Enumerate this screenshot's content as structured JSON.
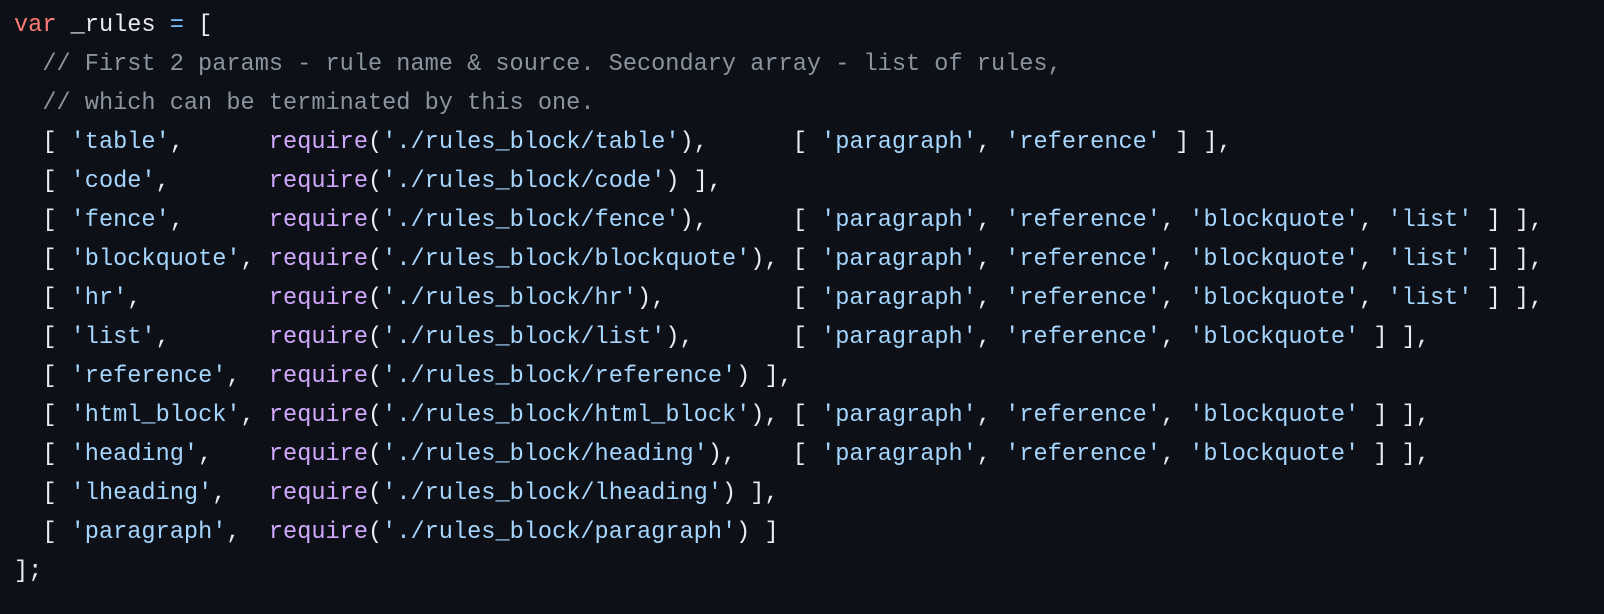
{
  "theme": {
    "background": "#0d1117",
    "text": "#e6edf3",
    "keyword": "#ff7b72",
    "operator": "#79c0ff",
    "comment": "#8b949e",
    "string": "#a5d6ff",
    "function": "#d2a8ff"
  },
  "code": {
    "lines": [
      [
        [
          "kw",
          "var"
        ],
        [
          "p",
          " _rules "
        ],
        [
          "op",
          "="
        ],
        [
          "p",
          " ["
        ]
      ],
      [
        [
          "cm",
          "  // First 2 params - rule name & source. Secondary array - list of rules,"
        ]
      ],
      [
        [
          "cm",
          "  // which can be terminated by this one."
        ]
      ],
      [
        [
          "p",
          "  [ "
        ],
        [
          "str",
          "'table'"
        ],
        [
          "p",
          ",      "
        ],
        [
          "fn",
          "require"
        ],
        [
          "p",
          "("
        ],
        [
          "str",
          "'./rules_block/table'"
        ],
        [
          "p",
          "),      [ "
        ],
        [
          "str",
          "'paragraph'"
        ],
        [
          "p",
          ", "
        ],
        [
          "str",
          "'reference'"
        ],
        [
          "p",
          " ] ],"
        ]
      ],
      [
        [
          "p",
          "  [ "
        ],
        [
          "str",
          "'code'"
        ],
        [
          "p",
          ",       "
        ],
        [
          "fn",
          "require"
        ],
        [
          "p",
          "("
        ],
        [
          "str",
          "'./rules_block/code'"
        ],
        [
          "p",
          ") ],"
        ]
      ],
      [
        [
          "p",
          "  [ "
        ],
        [
          "str",
          "'fence'"
        ],
        [
          "p",
          ",      "
        ],
        [
          "fn",
          "require"
        ],
        [
          "p",
          "("
        ],
        [
          "str",
          "'./rules_block/fence'"
        ],
        [
          "p",
          "),      [ "
        ],
        [
          "str",
          "'paragraph'"
        ],
        [
          "p",
          ", "
        ],
        [
          "str",
          "'reference'"
        ],
        [
          "p",
          ", "
        ],
        [
          "str",
          "'blockquote'"
        ],
        [
          "p",
          ", "
        ],
        [
          "str",
          "'list'"
        ],
        [
          "p",
          " ] ],"
        ]
      ],
      [
        [
          "p",
          "  [ "
        ],
        [
          "str",
          "'blockquote'"
        ],
        [
          "p",
          ", "
        ],
        [
          "fn",
          "require"
        ],
        [
          "p",
          "("
        ],
        [
          "str",
          "'./rules_block/blockquote'"
        ],
        [
          "p",
          "), [ "
        ],
        [
          "str",
          "'paragraph'"
        ],
        [
          "p",
          ", "
        ],
        [
          "str",
          "'reference'"
        ],
        [
          "p",
          ", "
        ],
        [
          "str",
          "'blockquote'"
        ],
        [
          "p",
          ", "
        ],
        [
          "str",
          "'list'"
        ],
        [
          "p",
          " ] ],"
        ]
      ],
      [
        [
          "p",
          "  [ "
        ],
        [
          "str",
          "'hr'"
        ],
        [
          "p",
          ",         "
        ],
        [
          "fn",
          "require"
        ],
        [
          "p",
          "("
        ],
        [
          "str",
          "'./rules_block/hr'"
        ],
        [
          "p",
          "),         [ "
        ],
        [
          "str",
          "'paragraph'"
        ],
        [
          "p",
          ", "
        ],
        [
          "str",
          "'reference'"
        ],
        [
          "p",
          ", "
        ],
        [
          "str",
          "'blockquote'"
        ],
        [
          "p",
          ", "
        ],
        [
          "str",
          "'list'"
        ],
        [
          "p",
          " ] ],"
        ]
      ],
      [
        [
          "p",
          "  [ "
        ],
        [
          "str",
          "'list'"
        ],
        [
          "p",
          ",       "
        ],
        [
          "fn",
          "require"
        ],
        [
          "p",
          "("
        ],
        [
          "str",
          "'./rules_block/list'"
        ],
        [
          "p",
          "),       [ "
        ],
        [
          "str",
          "'paragraph'"
        ],
        [
          "p",
          ", "
        ],
        [
          "str",
          "'reference'"
        ],
        [
          "p",
          ", "
        ],
        [
          "str",
          "'blockquote'"
        ],
        [
          "p",
          " ] ],"
        ]
      ],
      [
        [
          "p",
          "  [ "
        ],
        [
          "str",
          "'reference'"
        ],
        [
          "p",
          ",  "
        ],
        [
          "fn",
          "require"
        ],
        [
          "p",
          "("
        ],
        [
          "str",
          "'./rules_block/reference'"
        ],
        [
          "p",
          ") ],"
        ]
      ],
      [
        [
          "p",
          "  [ "
        ],
        [
          "str",
          "'html_block'"
        ],
        [
          "p",
          ", "
        ],
        [
          "fn",
          "require"
        ],
        [
          "p",
          "("
        ],
        [
          "str",
          "'./rules_block/html_block'"
        ],
        [
          "p",
          "), [ "
        ],
        [
          "str",
          "'paragraph'"
        ],
        [
          "p",
          ", "
        ],
        [
          "str",
          "'reference'"
        ],
        [
          "p",
          ", "
        ],
        [
          "str",
          "'blockquote'"
        ],
        [
          "p",
          " ] ],"
        ]
      ],
      [
        [
          "p",
          "  [ "
        ],
        [
          "str",
          "'heading'"
        ],
        [
          "p",
          ",    "
        ],
        [
          "fn",
          "require"
        ],
        [
          "p",
          "("
        ],
        [
          "str",
          "'./rules_block/heading'"
        ],
        [
          "p",
          "),    [ "
        ],
        [
          "str",
          "'paragraph'"
        ],
        [
          "p",
          ", "
        ],
        [
          "str",
          "'reference'"
        ],
        [
          "p",
          ", "
        ],
        [
          "str",
          "'blockquote'"
        ],
        [
          "p",
          " ] ],"
        ]
      ],
      [
        [
          "p",
          "  [ "
        ],
        [
          "str",
          "'lheading'"
        ],
        [
          "p",
          ",   "
        ],
        [
          "fn",
          "require"
        ],
        [
          "p",
          "("
        ],
        [
          "str",
          "'./rules_block/lheading'"
        ],
        [
          "p",
          ") ],"
        ]
      ],
      [
        [
          "p",
          "  [ "
        ],
        [
          "str",
          "'paragraph'"
        ],
        [
          "p",
          ",  "
        ],
        [
          "fn",
          "require"
        ],
        [
          "p",
          "("
        ],
        [
          "str",
          "'./rules_block/paragraph'"
        ],
        [
          "p",
          ") ]"
        ]
      ],
      [
        [
          "p",
          "];"
        ]
      ]
    ]
  }
}
